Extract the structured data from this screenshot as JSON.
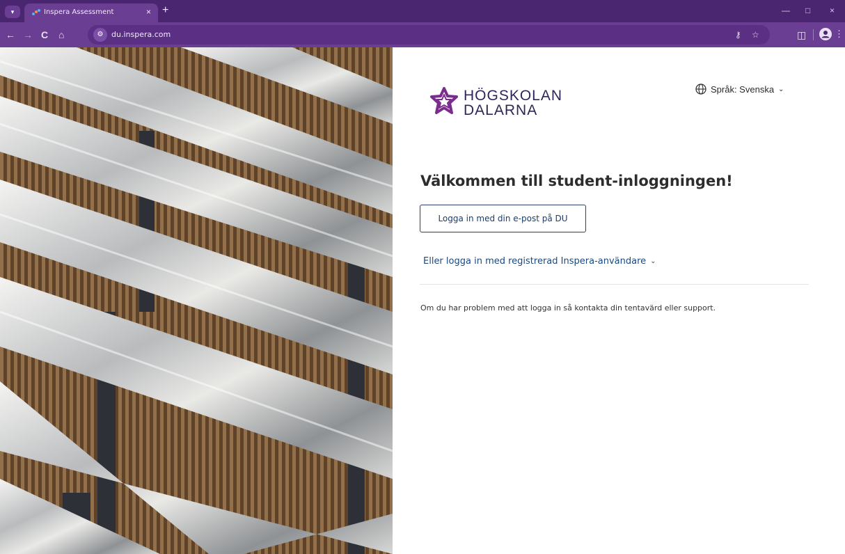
{
  "browser": {
    "tab": {
      "title": "Inspera Assessment",
      "close": "×"
    },
    "new_tab": "+",
    "window_controls": {
      "minimize": "—",
      "maximize": "□",
      "close": "×"
    },
    "nav": {
      "back": "←",
      "forward": "→",
      "reload": "C",
      "home": "⌂"
    },
    "url": "du.inspera.com",
    "colors": {
      "frame": "#4b2670",
      "toolbar": "#6a3e93"
    }
  },
  "page": {
    "logo": {
      "line1": "HÖGSKOLAN",
      "line2": "DALARNA",
      "color": "#30255a",
      "mark_color": "#7b2d8e"
    },
    "language": {
      "label": "Språk: Svenska",
      "chevron": "⌄"
    },
    "welcome": "Välkommen till student-inloggningen!",
    "sso_button": "Logga in med din e-post på DU",
    "alt_login": {
      "label": "Eller logga in med registrerad Inspera-användare",
      "chevron": "⌄"
    },
    "help_text": "Om du har problem med att logga in så kontakta din tentavärd eller support.",
    "colors": {
      "button_text": "#1d3c6b",
      "link": "#1a4a80"
    }
  }
}
